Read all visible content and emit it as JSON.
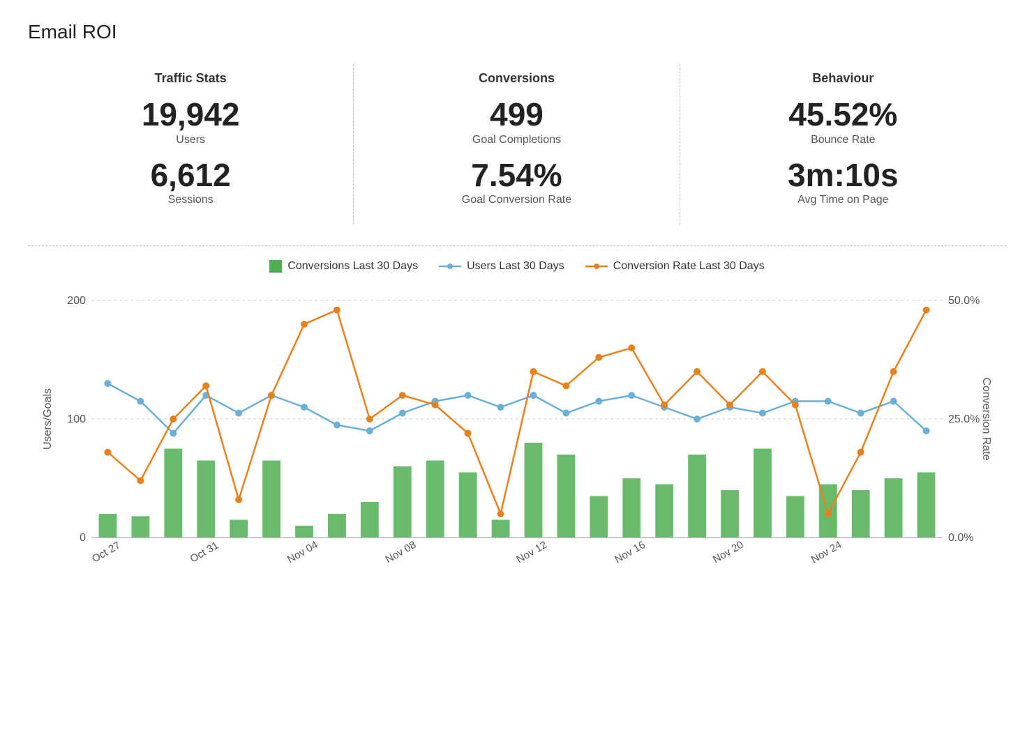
{
  "title": "Email ROI",
  "sections": {
    "traffic": {
      "title": "Traffic Stats",
      "stats": [
        {
          "value": "19,942",
          "label": "Users"
        },
        {
          "value": "6,612",
          "label": "Sessions"
        }
      ]
    },
    "conversions": {
      "title": "Conversions",
      "stats": [
        {
          "value": "499",
          "label": "Goal Completions"
        },
        {
          "value": "7.54%",
          "label": "Goal Conversion Rate"
        }
      ]
    },
    "behaviour": {
      "title": "Behaviour",
      "stats": [
        {
          "value": "45.52%",
          "label": "Bounce Rate"
        },
        {
          "value": "3m:10s",
          "label": "Avg Time on Page"
        }
      ]
    }
  },
  "legend": {
    "conversions_label": "Conversions Last 30 Days",
    "users_label": "Users Last 30 Days",
    "rate_label": "Conversion Rate Last 30 Days"
  },
  "chart": {
    "y_left_label": "Users/Goals",
    "y_right_label": "Conversion Rate",
    "y_left_max": 200,
    "y_left_ticks": [
      0,
      100,
      200
    ],
    "y_right_ticks": [
      "0.0%",
      "25.0%",
      "50.0%"
    ],
    "x_labels": [
      "Oct 27",
      "Oct 31",
      "Nov 04",
      "Nov 08",
      "Nov 12",
      "Nov 16",
      "Nov 20",
      "Nov 24"
    ],
    "bars": [
      20,
      18,
      75,
      65,
      15,
      65,
      10,
      20,
      30,
      60,
      65,
      55,
      15,
      80,
      70,
      35,
      50,
      45,
      70,
      40,
      75,
      35,
      45,
      40,
      50,
      55
    ],
    "users_line": [
      130,
      115,
      88,
      120,
      105,
      120,
      110,
      95,
      90,
      105,
      115,
      120,
      110,
      120,
      105,
      115,
      120,
      110,
      100,
      110,
      105,
      115,
      115,
      105,
      115,
      90
    ],
    "rate_line": [
      18,
      12,
      25,
      32,
      8,
      30,
      45,
      48,
      25,
      30,
      28,
      22,
      5,
      35,
      32,
      38,
      40,
      28,
      35,
      28,
      35,
      28,
      5,
      18,
      35,
      48
    ]
  }
}
